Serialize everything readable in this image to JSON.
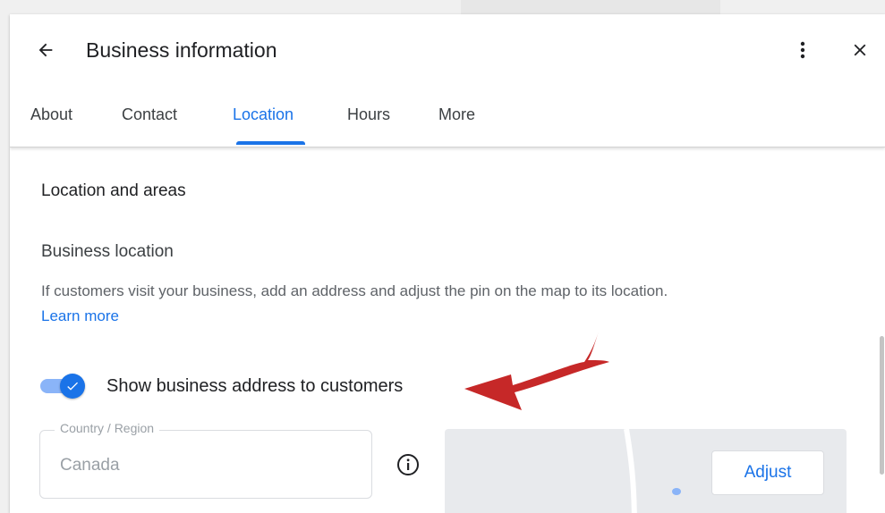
{
  "header": {
    "title": "Business information",
    "back_icon": "arrow-left-icon",
    "more_icon": "more-vert-icon",
    "close_icon": "close-icon"
  },
  "tabs": [
    {
      "label": "About",
      "active": false
    },
    {
      "label": "Contact",
      "active": false
    },
    {
      "label": "Location",
      "active": true
    },
    {
      "label": "Hours",
      "active": false
    },
    {
      "label": "More",
      "active": false
    }
  ],
  "section": {
    "title": "Location and areas",
    "business_location": {
      "title": "Business location",
      "description": "If customers visit your business, add an address and adjust the pin on the map to its location.",
      "learn_more": "Learn more"
    },
    "show_address_toggle": {
      "label": "Show business address to customers",
      "checked": true
    },
    "country_field": {
      "label": "Country / Region",
      "value": "Canada"
    },
    "map": {
      "adjust_label": "Adjust"
    }
  },
  "colors": {
    "accent": "#1a73e8",
    "annotation_arrow": "#c62828"
  }
}
